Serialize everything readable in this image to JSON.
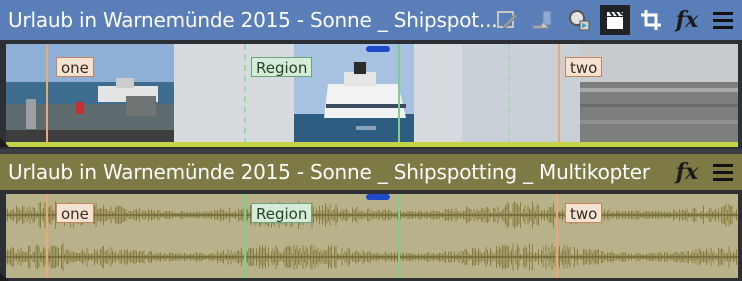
{
  "video_track": {
    "title": "Urlaub in Warnemünde 2015 - Sonne _ Shipspot...",
    "icons": [
      "event-pan-crop-icon",
      "generated-media-icon",
      "media-properties-icon",
      "clapperboard-icon",
      "crop-icon",
      "fx-icon",
      "menu-icon"
    ],
    "fx_label": "fx"
  },
  "audio_track": {
    "title": "Urlaub in Warnemünde 2015 - Sonne _ Shipspotting _ Multikopter",
    "icons": [
      "fx-icon",
      "menu-icon"
    ],
    "fx_label": "fx"
  },
  "markers": [
    {
      "label": "one",
      "kind": "marker"
    },
    {
      "label": "Region",
      "kind": "region"
    },
    {
      "label": "two",
      "kind": "marker"
    }
  ],
  "colors": {
    "video_header": "#5a7fb8",
    "audio_header": "#7e7a45",
    "marker": "#e9a877",
    "region": "#7fcf8c",
    "waveform": "#7a6d2c"
  }
}
